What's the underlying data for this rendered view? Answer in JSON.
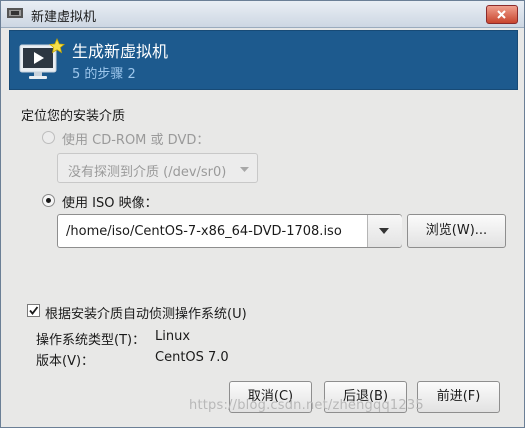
{
  "window": {
    "title": "新建虚拟机"
  },
  "banner": {
    "title": "生成新虚拟机",
    "step": "5 的步骤 2"
  },
  "install_media": {
    "section_label": "定位您的安装介质",
    "cdrom_option": {
      "label": "使用 CD-ROM 或 DVD：",
      "selected": false,
      "enabled": false
    },
    "cdrom_select": {
      "value": "没有探测到介质 (/dev/sr0)"
    },
    "iso_option": {
      "label": "使用 ISO 映像：",
      "selected": true
    },
    "iso_path": {
      "value": "/home/iso/CentOS-7-x86_64-DVD-1708.iso"
    },
    "browse_label": "浏览(W)..."
  },
  "auto_detect": {
    "label": "根据安装介质自动侦测操作系统(U)",
    "checked": true
  },
  "os_info": {
    "type_label": "操作系统类型(T)：",
    "type_value": "Linux",
    "version_label": "版本(V)：",
    "version_value": "CentOS 7.0"
  },
  "footer": {
    "cancel_label": "取消(C)",
    "back_label": "后退(B)",
    "forward_label": "前进(F)"
  },
  "watermark": "https://blog.csdn.net/zhengqq1235"
}
